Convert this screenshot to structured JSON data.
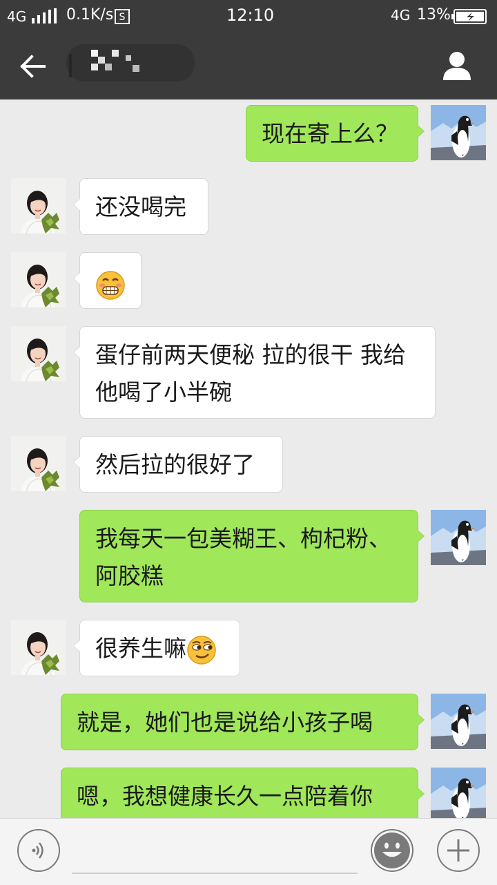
{
  "status_bar": {
    "network_left": "4G",
    "speed": "0.1K/s",
    "time": "12:10",
    "network_right": "4G",
    "battery": "13%"
  },
  "title_bar": {
    "back_icon": "arrow-left-icon",
    "contact_icon": "person-icon"
  },
  "colors": {
    "header": "#3b3b3b",
    "background": "#ebebeb",
    "outgoing_bubble": "#a0e75a",
    "incoming_bubble": "#ffffff"
  },
  "messages": [
    {
      "side": "out",
      "text": "现在寄上么？"
    },
    {
      "side": "in",
      "text": "还没喝完"
    },
    {
      "side": "in",
      "text": "",
      "emoji": "grinning-emoji"
    },
    {
      "side": "in",
      "text": "蛋仔前两天便秘 拉的很干 我给他喝了小半碗"
    },
    {
      "side": "in",
      "text": "然后拉的很好了"
    },
    {
      "side": "out",
      "text": "我每天一包美糊王、枸杞粉、阿胶糕"
    },
    {
      "side": "in",
      "text": "很养生嘛",
      "emoji": "smirk-emoji"
    },
    {
      "side": "out",
      "text": "就是，她们也是说给小孩子喝"
    },
    {
      "side": "out",
      "text": "嗯，我想健康长久一点陪着你"
    }
  ],
  "input_bar": {
    "voice_icon": "voice-icon",
    "emoji_icon": "smiley-icon",
    "more_icon": "plus-icon",
    "input_value": ""
  }
}
